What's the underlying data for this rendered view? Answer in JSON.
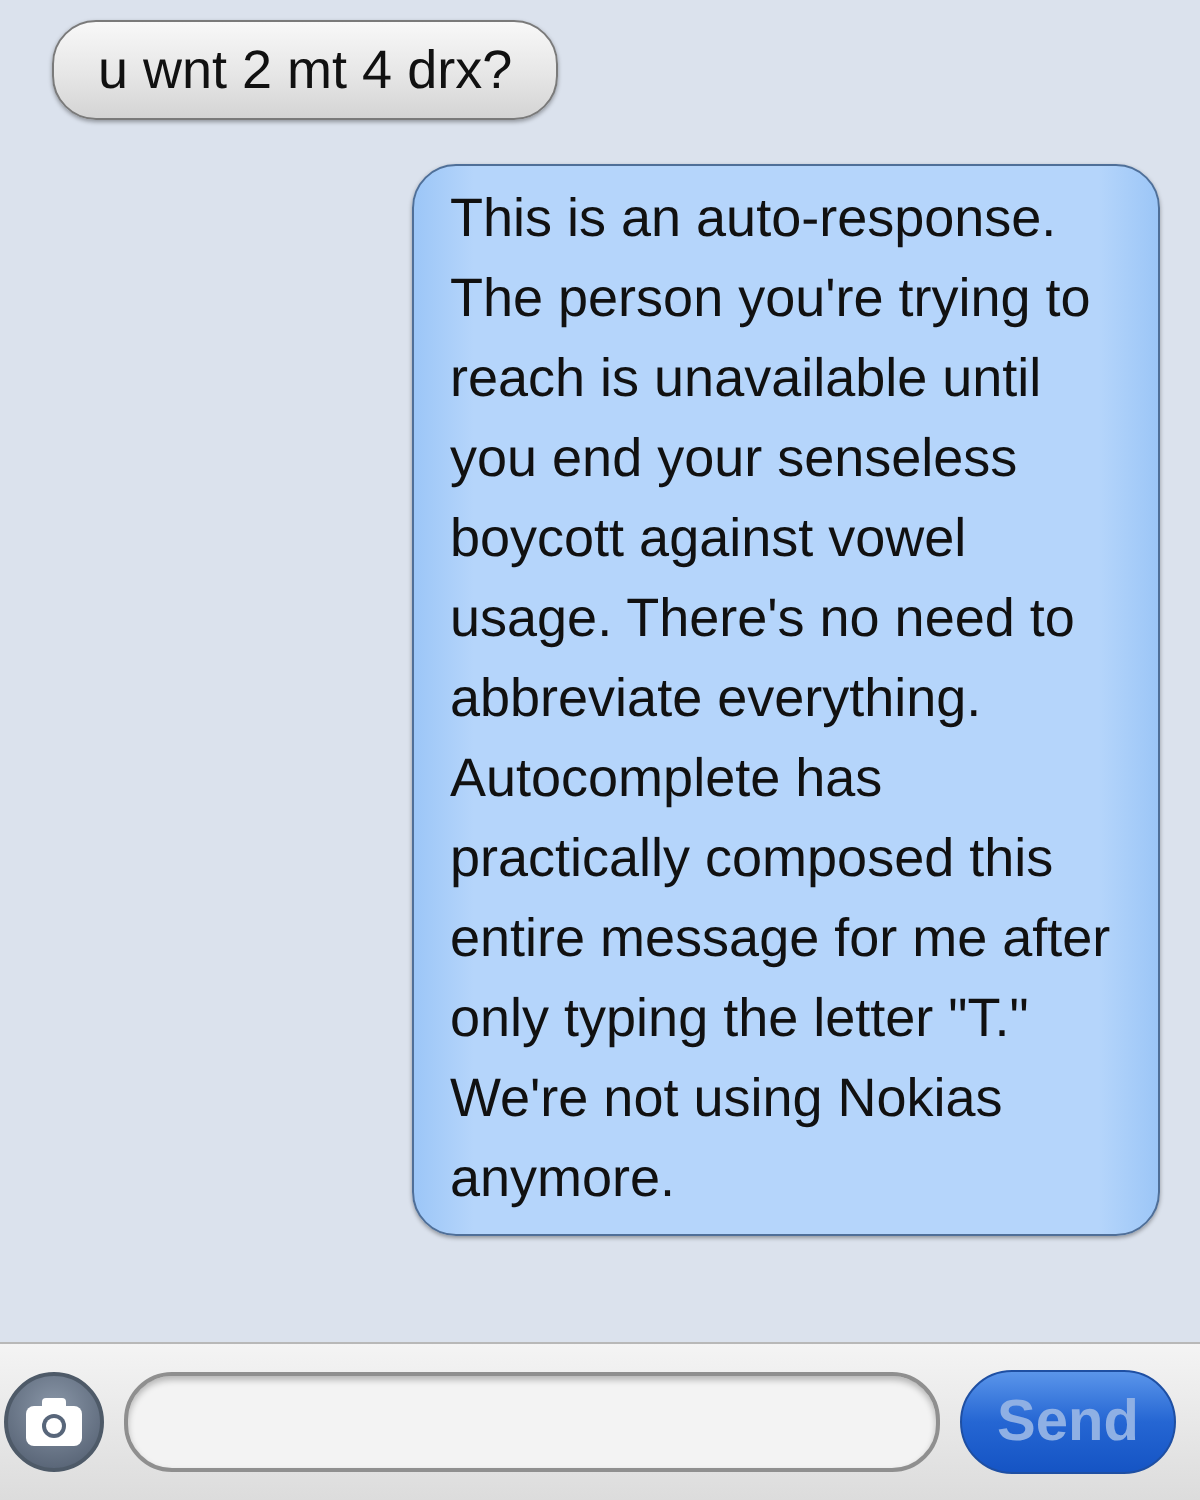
{
  "messages": [
    {
      "kind": "incoming",
      "text": "u wnt 2 mt 4 drx?"
    },
    {
      "kind": "outgoing",
      "text": "This is an auto-response. The person you're trying to reach is unavailable until you end your senseless boycott against vowel usage. There's no need to abbreviate everything. Autocomplete has practically composed this entire message for me after only typing the letter \"T.\" We're not using Nokias anymore."
    }
  ],
  "composer": {
    "send": {
      "label": "Send",
      "disabled": true
    }
  }
}
